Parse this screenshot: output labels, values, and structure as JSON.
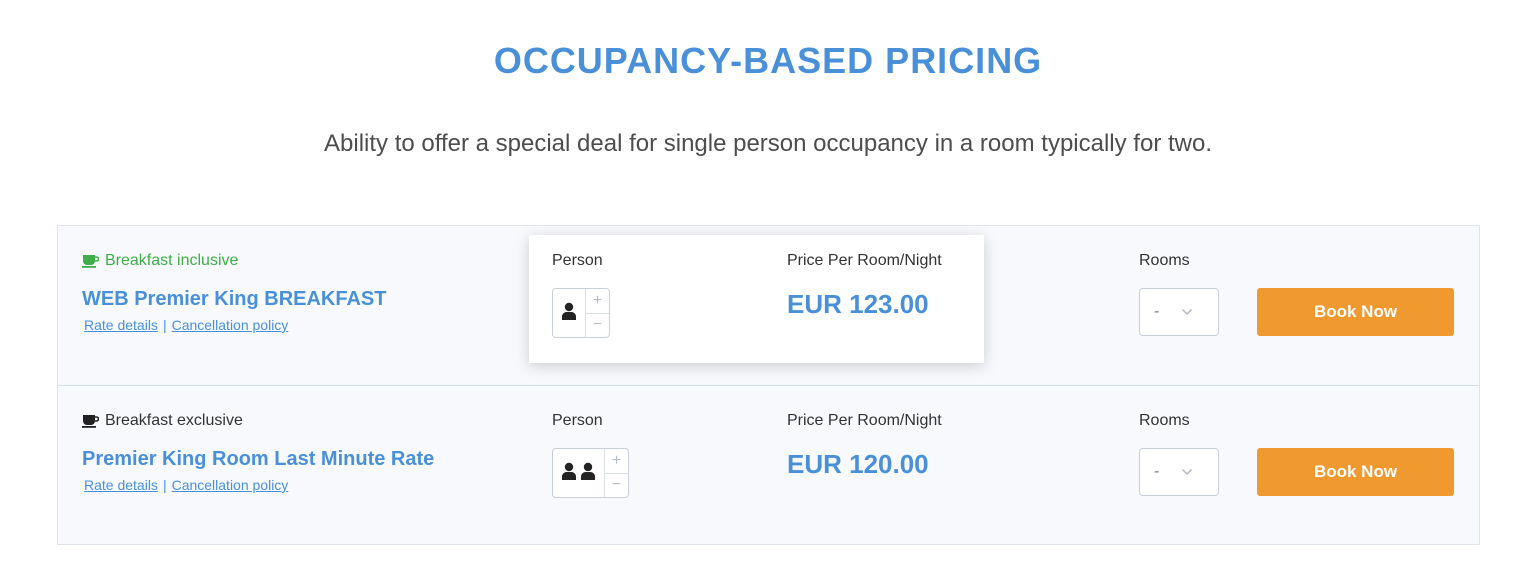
{
  "header": {
    "title": "OCCUPANCY-BASED PRICING",
    "subtitle": "Ability to offer a special deal for single person occupancy in a room typically for two."
  },
  "labels": {
    "person": "Person",
    "price": "Price Per Room/Night",
    "rooms": "Rooms",
    "rate_details": "Rate details",
    "separator": "|",
    "cancellation": "Cancellation policy",
    "book_now": "Book Now"
  },
  "rates": [
    {
      "breakfast": "Breakfast inclusive",
      "room_name": "WEB Premier King BREAKFAST",
      "persons": 1,
      "price": "EUR 123.00",
      "rooms_value": "-",
      "highlighted": true
    },
    {
      "breakfast": "Breakfast exclusive",
      "room_name": "Premier King Room Last Minute Rate",
      "persons": 2,
      "price": "EUR 120.00",
      "rooms_value": "-",
      "highlighted": false
    }
  ],
  "icons": {
    "breakfast": "coffee-cup-icon",
    "person": "person-icon",
    "increment": "+",
    "decrement": "−",
    "select": "chevron-down-icon"
  },
  "colors": {
    "accent_blue": "#4a90d9",
    "breakfast_green": "#3fae49",
    "book_orange": "#f0992e"
  }
}
